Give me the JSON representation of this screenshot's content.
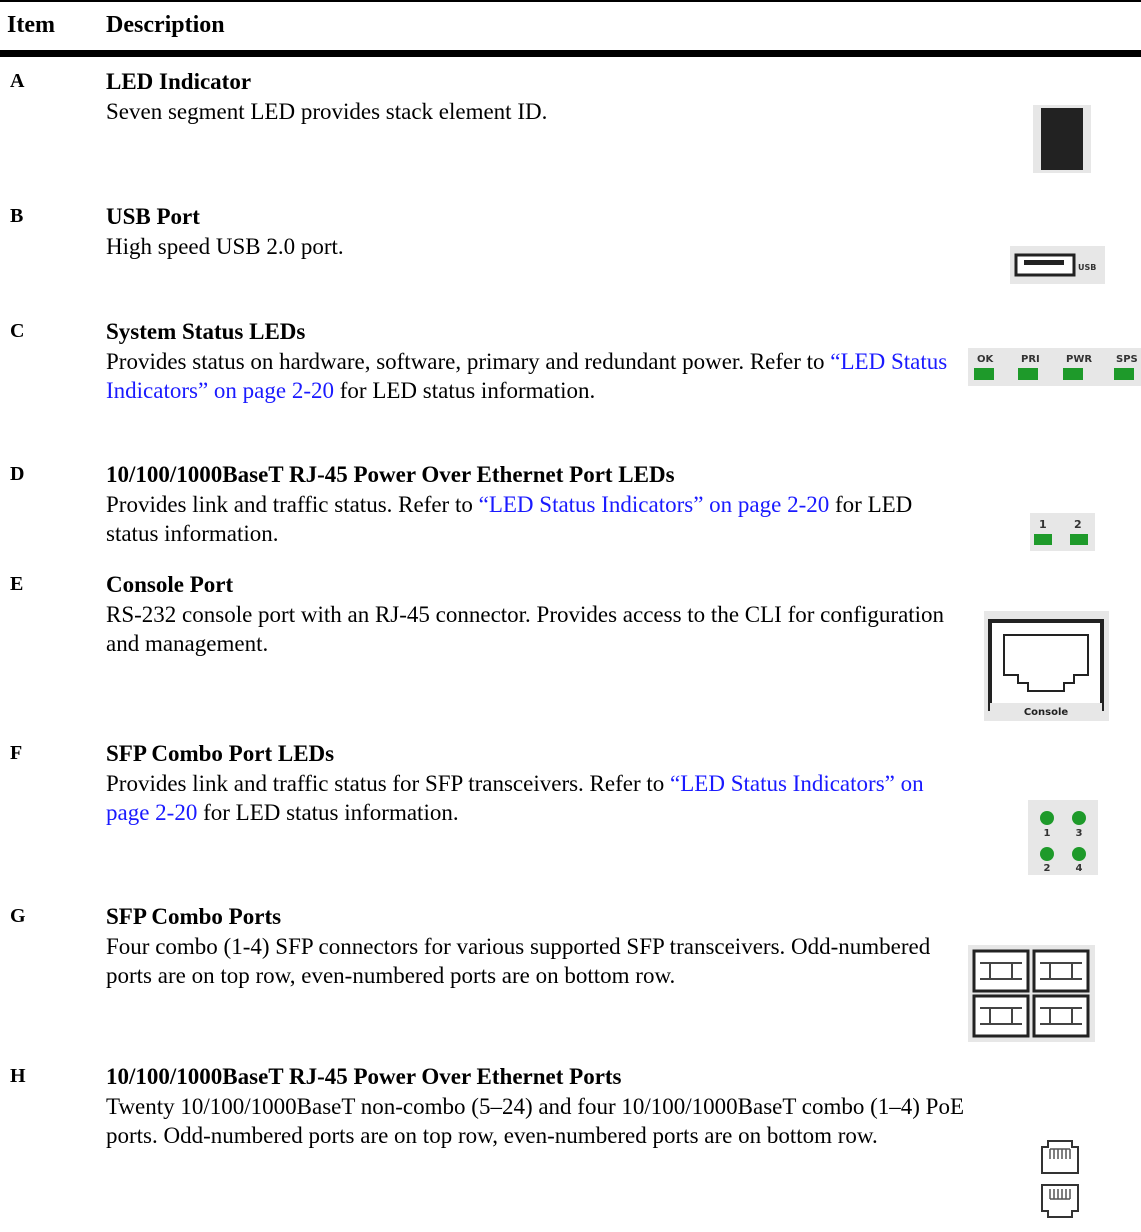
{
  "header": {
    "item": "Item",
    "description": "Description"
  },
  "rows": [
    {
      "letter": "A",
      "title": "LED Indicator",
      "text": "Seven segment LED provides stack element ID."
    },
    {
      "letter": "B",
      "title": "USB Port",
      "text": "High speed USB 2.0 port.",
      "figure_label": "USB"
    },
    {
      "letter": "C",
      "title": "System Status LEDs",
      "text_before": "Provides status on hardware, software, primary and redundant power. Refer to ",
      "link": "“LED Status Indicators” on page 2-20",
      "text_after": " for LED status information.",
      "figure_labels": [
        "OK",
        "PRI",
        "PWR",
        "SPS"
      ]
    },
    {
      "letter": "D",
      "title": "10/100/1000BaseT RJ-45 Power Over Ethernet Port LEDs",
      "text_before": "Provides link and traffic status. Refer to ",
      "link": "“LED Status Indicators” on page 2-20",
      "text_after": " for LED status information.",
      "figure_labels": [
        "1",
        "2"
      ]
    },
    {
      "letter": "E",
      "title": "Console Port",
      "text": "RS-232 console port with an RJ-45 connector. Provides access to the CLI for configuration and management.",
      "figure_label": "Console"
    },
    {
      "letter": "F",
      "title": "SFP Combo Port LEDs",
      "text_before": "Provides link and traffic status for SFP transceivers. Refer to ",
      "link": "“LED Status Indicators” on page 2-20",
      "text_after": " for LED status information.",
      "figure_labels": [
        "1",
        "3",
        "2",
        "4"
      ]
    },
    {
      "letter": "G",
      "title": "SFP Combo Ports",
      "text": "Four combo (1-4) SFP connectors for various supported SFP transceivers. Odd-numbered ports are on top row, even-numbered ports are on bottom row."
    },
    {
      "letter": "H",
      "title": "10/100/1000BaseT RJ-45 Power Over Ethernet Ports",
      "text": "Twenty 10/100/1000BaseT non-combo (5–24) and four 10/100/1000BaseT combo (1–4) PoE ports. Odd-numbered ports are on top row, even-numbered ports are on bottom row."
    }
  ],
  "colors": {
    "link": "#1a1aff",
    "led_green": "#1e9a2a",
    "figure_background": "#e7e7e7"
  },
  "icons": [
    "seven-segment-led-icon",
    "usb-port-icon",
    "system-status-leds-icon",
    "poe-port-leds-icon",
    "console-port-icon",
    "sfp-port-leds-icon",
    "sfp-ports-icon",
    "rj45-ports-icon"
  ]
}
